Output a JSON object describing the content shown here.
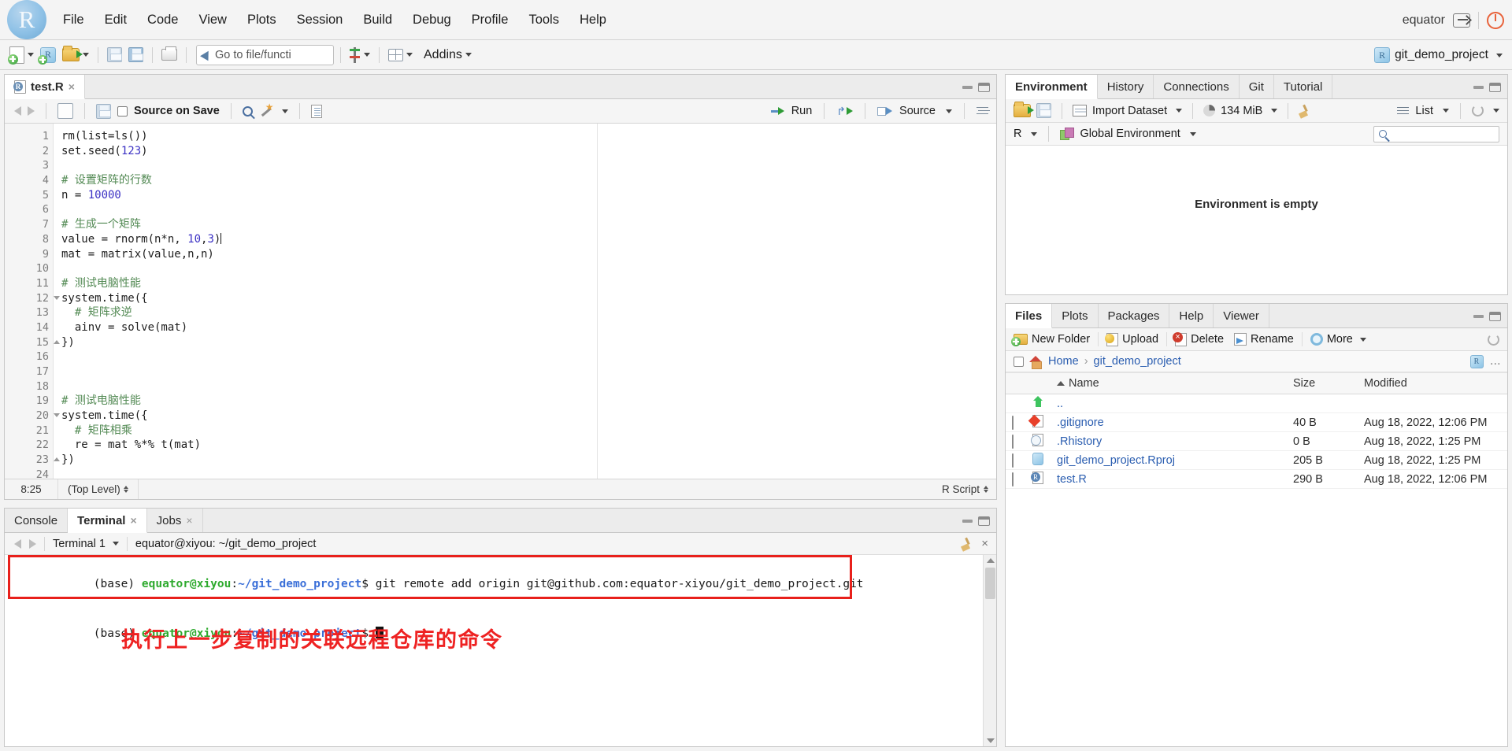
{
  "menubar": {
    "logo_text": "R",
    "items": [
      "File",
      "Edit",
      "Code",
      "View",
      "Plots",
      "Session",
      "Build",
      "Debug",
      "Profile",
      "Tools",
      "Help"
    ],
    "user": "equator"
  },
  "toolbar": {
    "goto_placeholder": "Go to file/functi",
    "addins_label": "Addins",
    "project_label": "git_demo_project"
  },
  "editor": {
    "tab_label": "test.R",
    "source_on_save_label": "Source on Save",
    "run_label": "Run",
    "source_label": "Source",
    "status_position": "8:25",
    "status_scope": "(Top Level)",
    "status_type": "R Script",
    "lines": [
      {
        "n": "1",
        "fold": "",
        "code": "rm(list=ls())"
      },
      {
        "n": "2",
        "fold": "",
        "code": "set.seed(123)"
      },
      {
        "n": "3",
        "fold": "",
        "code": ""
      },
      {
        "n": "4",
        "fold": "",
        "code": "# 设置矩阵的行数"
      },
      {
        "n": "5",
        "fold": "",
        "code": "n = 10000"
      },
      {
        "n": "6",
        "fold": "",
        "code": ""
      },
      {
        "n": "7",
        "fold": "",
        "code": "# 生成一个矩阵"
      },
      {
        "n": "8",
        "fold": "",
        "code": "value = rnorm(n*n, 10,3)"
      },
      {
        "n": "9",
        "fold": "",
        "code": "mat = matrix(value,n,n)"
      },
      {
        "n": "10",
        "fold": "",
        "code": ""
      },
      {
        "n": "11",
        "fold": "",
        "code": "# 测试电脑性能"
      },
      {
        "n": "12",
        "fold": "d",
        "code": "system.time({"
      },
      {
        "n": "13",
        "fold": "",
        "code": "  # 矩阵求逆"
      },
      {
        "n": "14",
        "fold": "",
        "code": "  ainv = solve(mat)"
      },
      {
        "n": "15",
        "fold": "u",
        "code": "})"
      },
      {
        "n": "16",
        "fold": "",
        "code": ""
      },
      {
        "n": "17",
        "fold": "",
        "code": ""
      },
      {
        "n": "18",
        "fold": "",
        "code": ""
      },
      {
        "n": "19",
        "fold": "",
        "code": "# 测试电脑性能"
      },
      {
        "n": "20",
        "fold": "d",
        "code": "system.time({"
      },
      {
        "n": "21",
        "fold": "",
        "code": "  # 矩阵相乘"
      },
      {
        "n": "22",
        "fold": "",
        "code": "  re = mat %*% t(mat)"
      },
      {
        "n": "23",
        "fold": "u",
        "code": "})"
      },
      {
        "n": "24",
        "fold": "",
        "code": ""
      }
    ]
  },
  "console_pane": {
    "tabs": [
      {
        "label": "Console",
        "closable": false,
        "active": false
      },
      {
        "label": "Terminal",
        "closable": true,
        "active": true
      },
      {
        "label": "Jobs",
        "closable": true,
        "active": false
      }
    ],
    "terminal_name": "Terminal 1",
    "terminal_path": "equator@xiyou: ~/git_demo_project",
    "line1": {
      "env": "(base) ",
      "user": "equator@xiyou",
      "colon": ":",
      "path": "~/git_demo_project",
      "prompt": "$ ",
      "command": "git remote add origin git@github.com:equator-xiyou/git_demo_project.git"
    },
    "line2": {
      "env": "(base) ",
      "user": "equator@xiyou",
      "colon": ":",
      "path": "~/git_demo_project",
      "prompt": "$ "
    },
    "annotation": "执行上一步复制的关联远程仓库的命令",
    "annotation_color": "#ee2222",
    "highlight_color": "#e8201b"
  },
  "environment_pane": {
    "tabs": [
      "Environment",
      "History",
      "Connections",
      "Git",
      "Tutorial"
    ],
    "active_tab": "Environment",
    "import_dataset_label": "Import Dataset",
    "memory_label": "134 MiB",
    "view_mode_label": "List",
    "language_label": "R",
    "scope_label": "Global Environment",
    "empty_message": "Environment is empty",
    "search_placeholder": ""
  },
  "files_pane": {
    "tabs": [
      "Files",
      "Plots",
      "Packages",
      "Help",
      "Viewer"
    ],
    "active_tab": "Files",
    "actions": [
      "New Folder",
      "Upload",
      "Delete",
      "Rename",
      "More"
    ],
    "breadcrumb": [
      "Home",
      "git_demo_project"
    ],
    "columns": [
      "Name",
      "Size",
      "Modified"
    ],
    "rows": [
      {
        "icon": "up-arrow-icon",
        "name": "..",
        "size": "",
        "modified": "",
        "checkbox": false
      },
      {
        "icon": "gitignore-icon",
        "name": ".gitignore",
        "size": "40 B",
        "modified": "Aug 18, 2022, 12:06 PM",
        "checkbox": true
      },
      {
        "icon": "rhistory-icon",
        "name": ".Rhistory",
        "size": "0 B",
        "modified": "Aug 18, 2022, 1:25 PM",
        "checkbox": true
      },
      {
        "icon": "rproj-icon",
        "name": "git_demo_project.Rproj",
        "size": "205 B",
        "modified": "Aug 18, 2022, 1:25 PM",
        "checkbox": true
      },
      {
        "icon": "rfile-icon",
        "name": "test.R",
        "size": "290 B",
        "modified": "Aug 18, 2022, 12:06 PM",
        "checkbox": true
      }
    ]
  }
}
